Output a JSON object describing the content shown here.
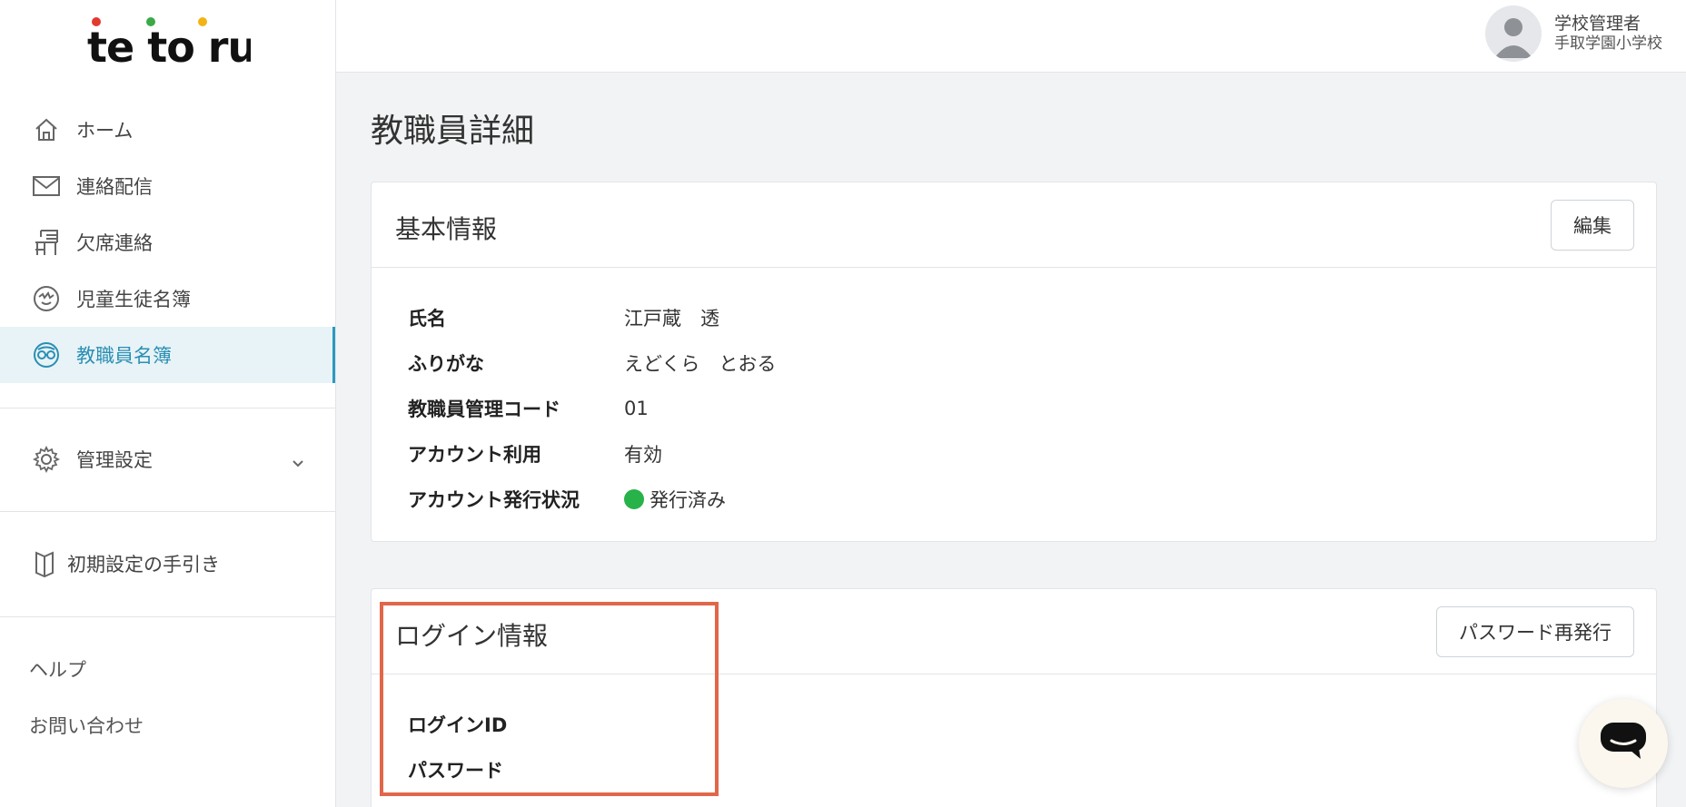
{
  "app": {
    "logo_text": "tetoru"
  },
  "sidebar": {
    "items": [
      {
        "label": "ホーム",
        "icon": "home-icon"
      },
      {
        "label": "連絡配信",
        "icon": "mail-icon"
      },
      {
        "label": "欠席連絡",
        "icon": "desk-icon"
      },
      {
        "label": "児童生徒名簿",
        "icon": "student-icon"
      },
      {
        "label": "教職員名簿",
        "icon": "teacher-icon",
        "active": true
      }
    ],
    "settings_label": "管理設定",
    "guide_label": "初期設定の手引き",
    "help_label": "ヘルプ",
    "contact_label": "お問い合わせ"
  },
  "header": {
    "user_role": "学校管理者",
    "user_school": "手取学園小学校"
  },
  "page": {
    "title": "教職員詳細"
  },
  "basic_info": {
    "title": "基本情報",
    "edit_label": "編集",
    "rows": [
      {
        "label": "氏名",
        "value": "江戸蔵　透"
      },
      {
        "label": "ふりがな",
        "value": "えどくら　とおる"
      },
      {
        "label": "教職員管理コード",
        "value": "01"
      },
      {
        "label": "アカウント利用",
        "value": "有効"
      },
      {
        "label": "アカウント発行状況",
        "value": "発行済み",
        "status_color": "#27b24a"
      }
    ]
  },
  "login_info": {
    "title": "ログイン情報",
    "reissue_label": "パスワード再発行",
    "rows": [
      {
        "label": "ログインID",
        "value": ""
      },
      {
        "label": "パスワード",
        "value": ""
      }
    ]
  },
  "colors": {
    "accent": "#2a9ac0",
    "highlight": "#e0674a"
  }
}
